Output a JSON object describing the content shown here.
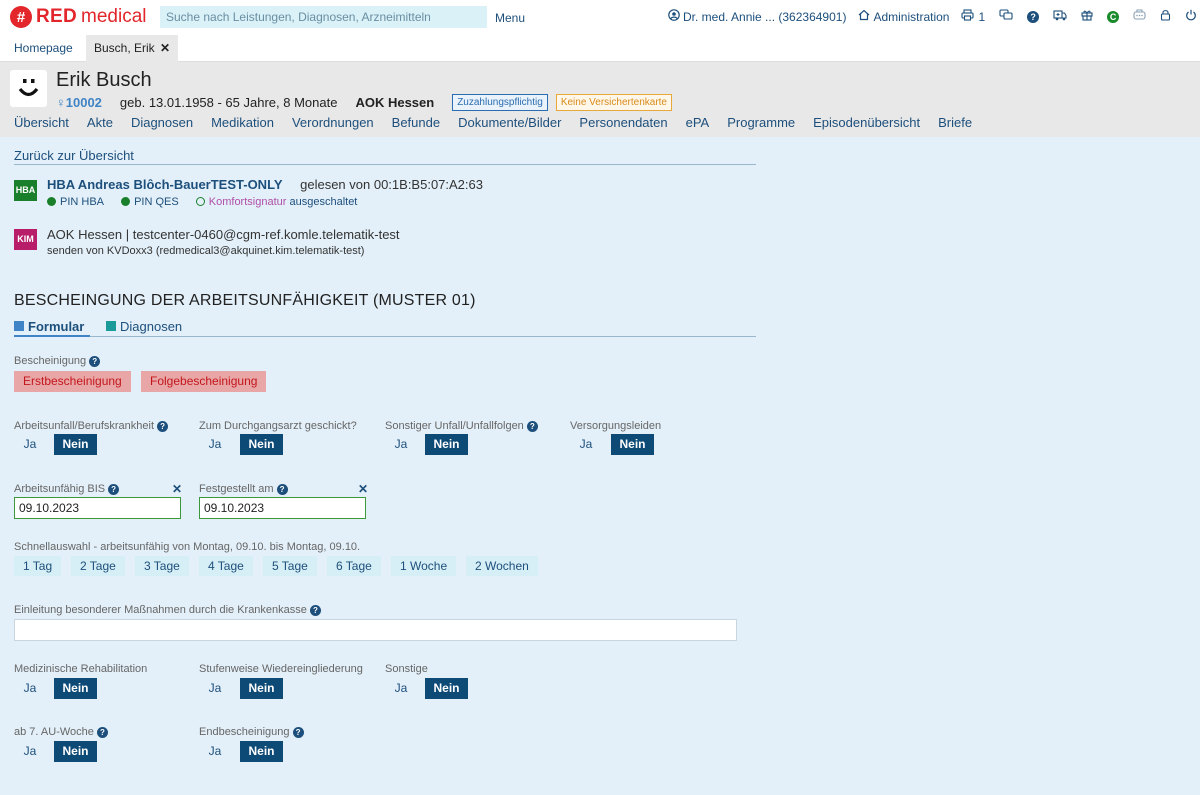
{
  "app": {
    "logo_brand": "RED",
    "logo_suffix": "medical",
    "search_placeholder": "Suche nach Leistungen, Diagnosen, Arzneimitteln",
    "menu_label": "Menu",
    "user_label": "Dr. med. Annie ... (362364901)",
    "admin_label": "Administration",
    "print_count": "1",
    "accent_color": "#e2262b"
  },
  "tabs": [
    {
      "label": "Homepage"
    },
    {
      "label": "Busch, Erik"
    }
  ],
  "patient": {
    "name": "Erik Busch",
    "id": "10002",
    "birth": "geb. 13.01.1958 - 65 Jahre, 8 Monate",
    "insurance": "AOK Hessen",
    "tag_copay": "Zuzahlungspflichtig",
    "tag_card": "Keine Versichertenkarte",
    "nav": [
      "Übersicht",
      "Akte",
      "Diagnosen",
      "Medikation",
      "Verordnungen",
      "Befunde",
      "Dokumente/Bilder",
      "Personendaten",
      "ePA",
      "Programme",
      "Episodenübersicht",
      "Briefe"
    ]
  },
  "content": {
    "back_link": "Zurück zur Übersicht",
    "hba": {
      "icon_text": "HBA",
      "name": "HBA Andreas Blôch-BauerTEST-ONLY",
      "read_info": "gelesen von 00:1B:B5:07:A2:63",
      "pin_hba": "PIN HBA",
      "pin_qes": "PIN QES",
      "comfort": "Komfortsignatur",
      "comfort_state": "ausgeschaltet"
    },
    "kim": {
      "icon_text": "KIM",
      "address": "AOK Hessen | testcenter-0460@cgm-ref.komle.telematik-test",
      "sender": "senden von KVDoxx3 (redmedical3@akquinet.kim.telematik-test)"
    },
    "form_title": "BESCHEINGUNG DER ARBEITSUNFÄHIGKEIT (MUSTER 01)",
    "subtab_form": "Formular",
    "subtab_diag": "Diagnosen",
    "bescheinigung_label": "Bescheinigung",
    "btn_erst": "Erstbescheinigung",
    "btn_folge": "Folgebescheinigung",
    "ja": "Ja",
    "nein": "Nein",
    "q_arbeitsunfall": "Arbeitsunfall/Berufskrankheit",
    "q_durchgangsarzt": "Zum Durchgangsarzt geschickt?",
    "q_sonstiger_unfall": "Sonstiger Unfall/Unfallfolgen",
    "q_versorgungsleiden": "Versorgungsleiden",
    "au_bis_label": "Arbeitsunfähig BIS",
    "au_bis_value": "09.10.2023",
    "festgestellt_label": "Festgestellt am",
    "festgestellt_value": "09.10.2023",
    "quick_label": "Schnellauswahl - arbeitsunfähig von Montag, 09.10. bis Montag, 09.10.",
    "quick_options": [
      "1 Tag",
      "2 Tage",
      "3 Tage",
      "4 Tage",
      "5 Tage",
      "6 Tage",
      "1 Woche",
      "2 Wochen"
    ],
    "einleitung_label": "Einleitung besonderer Maßnahmen durch die Krankenkasse",
    "einleitung_value": "",
    "q_reha": "Medizinische Rehabilitation",
    "q_stufenweise": "Stufenweise Wiedereingliederung",
    "q_sonstige": "Sonstige",
    "q_ab7": "ab 7. AU-Woche",
    "q_end": "Endbescheinigung"
  }
}
